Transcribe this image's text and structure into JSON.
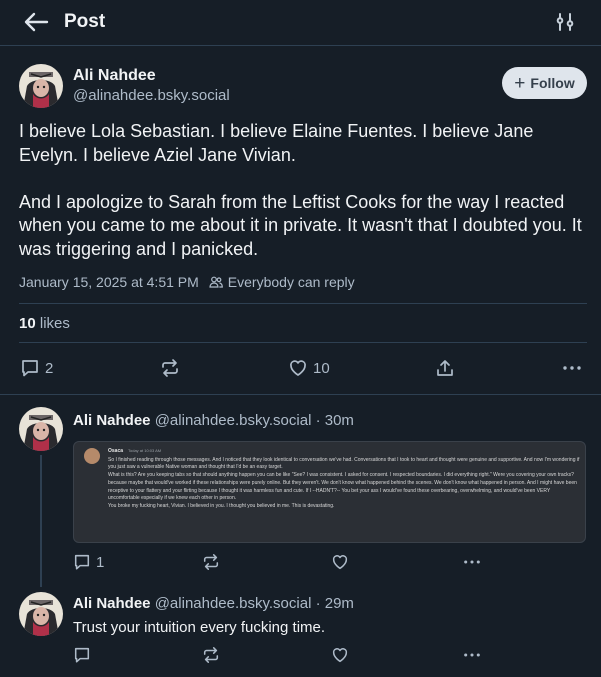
{
  "header": {
    "title": "Post",
    "back_icon": "arrow-left-icon",
    "filter_icon": "sliders-icon"
  },
  "post": {
    "author_name": "Ali Nahdee",
    "author_handle": "@alinahdee.bsky.social",
    "follow_label": "Follow",
    "paragraph_1": "I believe Lola Sebastian. I believe Elaine Fuentes. I believe Jane Evelyn. I believe Aziel Jane Vivian.",
    "paragraph_2": "And I apologize to Sarah from the Leftist Cooks for the way I reacted when you came to me about it in private. It wasn't that I doubted you. It was triggering and I panicked.",
    "timestamp": "January 15, 2025 at 4:51 PM",
    "reply_setting": "Everybody can reply",
    "likes_count": "10",
    "likes_label": "likes",
    "actions": {
      "reply_count": "2",
      "like_count": "10"
    }
  },
  "replies": [
    {
      "author_name": "Ali Nahdee",
      "author_handle": "@alinahdee.bsky.social",
      "time": "· 30m",
      "embed": {
        "name": "Osaca",
        "time": "Today at 10:03 AM",
        "lines": [
          "So I finished reading through those messages. And I noticed that they look identical to conversation we've had. Conversations that I took to heart and thought were genuine and supportive. And now I'm wondering if you just saw a vulnerable Native woman and thought that I'd be an easy target.",
          "What is this? Are you keeping tabs so that should anything happen you can be like \"See? I was consistent. I asked for consent. I respected boundaries. I did everything right.\" Were you covering your own tracks?",
          "because maybe that would've worked if these relationships were purely online. But they weren't. We don't know what happened behind the scenes. We don't know what happened in person. And I might have been receptive to your flattery and your flirting because I thought it was harmless fun and cute. If I --HADN'T?-- You bet your ass I would've found these overbearing, overwhelming, and would've been VERY uncomfortable especially if we knew each other in person.",
          "You broke my fucking heart, Vivian. I believed in you. I thought you believed in me. This is devastating."
        ]
      },
      "reply_count": "1"
    },
    {
      "author_name": "Ali Nahdee",
      "author_handle": "@alinahdee.bsky.social",
      "time": "· 29m",
      "text": "Trust your intuition every fucking time."
    }
  ],
  "colors": {
    "background": "#161e27",
    "border": "#2e4052",
    "muted": "#aebbc9",
    "text": "#f1f3f5"
  }
}
